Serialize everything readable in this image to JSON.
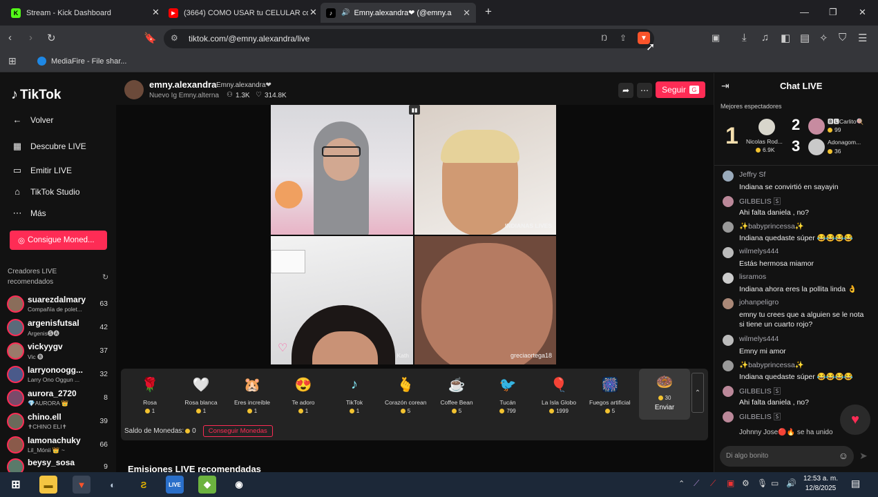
{
  "browser": {
    "tabs": [
      {
        "title": "Stream - Kick Dashboard",
        "icon": "kick-icon"
      },
      {
        "title": "(3664) COMO USAR tu CELULAR com",
        "icon": "youtube-icon"
      },
      {
        "title": "Emny.alexandra❤ (@emny.a",
        "icon": "tiktok-icon"
      }
    ],
    "url": "tiktok.com/@emny.alexandra/live",
    "bookmark": "MediaFire - File shar..."
  },
  "sidebar": {
    "logo": "TikTok",
    "items": [
      {
        "label": "Volver",
        "icon": "arrow-left-icon"
      },
      {
        "label": "Descubre LIVE",
        "icon": "calendar-icon"
      },
      {
        "label": "Emitir LIVE",
        "icon": "camera-icon"
      },
      {
        "label": "TikTok Studio",
        "icon": "home-icon"
      },
      {
        "label": "Más",
        "icon": "more-icon"
      }
    ],
    "coins_button": "Consigue Moned...",
    "creators_title": "Creadores LIVE\nrecomendados",
    "creators": [
      {
        "name": "suarezdalmary",
        "sub": "Compañía de polet...",
        "count": "63"
      },
      {
        "name": "argenisfutsal",
        "sub": "Argenis🅢🅐",
        "count": "42"
      },
      {
        "name": "vickyygv",
        "sub": "Vic 🅑",
        "count": "37"
      },
      {
        "name": "larryonoogg...",
        "sub": "Larry Ono Oggun ...",
        "count": "32"
      },
      {
        "name": "aurora_2720",
        "sub": "💎AURORA 👑",
        "count": "8"
      },
      {
        "name": "chino.ell",
        "sub": "✝CHINO ELI✝",
        "count": "39"
      },
      {
        "name": "lamonachuky",
        "sub": "Lil_Mónii 👑 ~",
        "count": "66"
      },
      {
        "name": "beysy_sosa",
        "sub": "",
        "count": "9"
      }
    ]
  },
  "live": {
    "username": "emny.alexandra",
    "display": "Emny.alexandra❤",
    "bio": "Nuevo Ig Emny.alterna",
    "viewers": "1.3K",
    "likes": "314.8K",
    "follow": "Seguir",
    "watermarks": [
      "INDIANAS LIVES",
      "Kath",
      "greciaortega18"
    ],
    "recommended_title": "Emisiones LIVE recomendadas"
  },
  "gifts": [
    {
      "name": "Rosa",
      "price": "1",
      "emoji": "🌹"
    },
    {
      "name": "Rosa blanca",
      "price": "1",
      "emoji": "🤍"
    },
    {
      "name": "Eres increíble",
      "price": "1",
      "emoji": "🐹"
    },
    {
      "name": "Te adoro",
      "price": "1",
      "emoji": "😍"
    },
    {
      "name": "TikTok",
      "price": "1",
      "emoji": "♪"
    },
    {
      "name": "Corazón coreano",
      "price": "5",
      "emoji": "🫰"
    },
    {
      "name": "Coffee Bean",
      "price": "5",
      "emoji": "☕"
    },
    {
      "name": "Tucán",
      "price": "799",
      "emoji": "🐦"
    },
    {
      "name": "La Isla Globo",
      "price": "1999",
      "emoji": "🎈"
    },
    {
      "name": "Fuegos artificiale...",
      "price": "5",
      "emoji": "🎆"
    },
    {
      "name": "Enviar",
      "price": "30",
      "emoji": "🍩"
    }
  ],
  "balance": {
    "label": "Saldo de Monedas:",
    "value": "0",
    "button": "Conseguir Monedas"
  },
  "chat": {
    "title": "Chat LIVE",
    "top_viewers_label": "Mejores espectadores",
    "ranks": [
      {
        "rank": "1",
        "name": "Nicolas Rod...",
        "coins": "6.9K"
      },
      {
        "rank": "2",
        "name": "🅱🅻Carlito🍭",
        "coins": "99"
      },
      {
        "rank": "3",
        "name": "Adonagom...",
        "coins": "36"
      }
    ],
    "messages": [
      {
        "user": "Jeffry Sf",
        "text": "Indiana  se convirtió en sayayin"
      },
      {
        "user": "GILBELIS 🅂",
        "text": "Ahi falta daniela , no?"
      },
      {
        "user": "✨babyprincessa✨",
        "text": "Indiana quedaste súper 😂😂😂😂"
      },
      {
        "user": "wilmelys444",
        "text": "Estás hermosa miamor"
      },
      {
        "user": "lisramos",
        "text": "Indiana ahora eres la pollita linda 👌"
      },
      {
        "user": "johanpeligro",
        "text": "emny tu crees que a alguien se le nota si tiene un cuarto rojo?"
      },
      {
        "user": "wilmelys444",
        "text": "Emny mi amor"
      },
      {
        "user": "✨babyprincessa✨",
        "text": "Indiana quedaste súper 😂😂😂😂"
      },
      {
        "user": "GILBELIS 🅂",
        "text": "Ahi falta daniela , no?"
      },
      {
        "user": "GILBELIS 🅂",
        "text": ""
      }
    ],
    "joined": "Johnny Jose🔴🔥 se ha unido",
    "input_placeholder": "Di algo bonito"
  },
  "taskbar": {
    "time": "12:53 a. m.",
    "date": "12/8/2025"
  }
}
